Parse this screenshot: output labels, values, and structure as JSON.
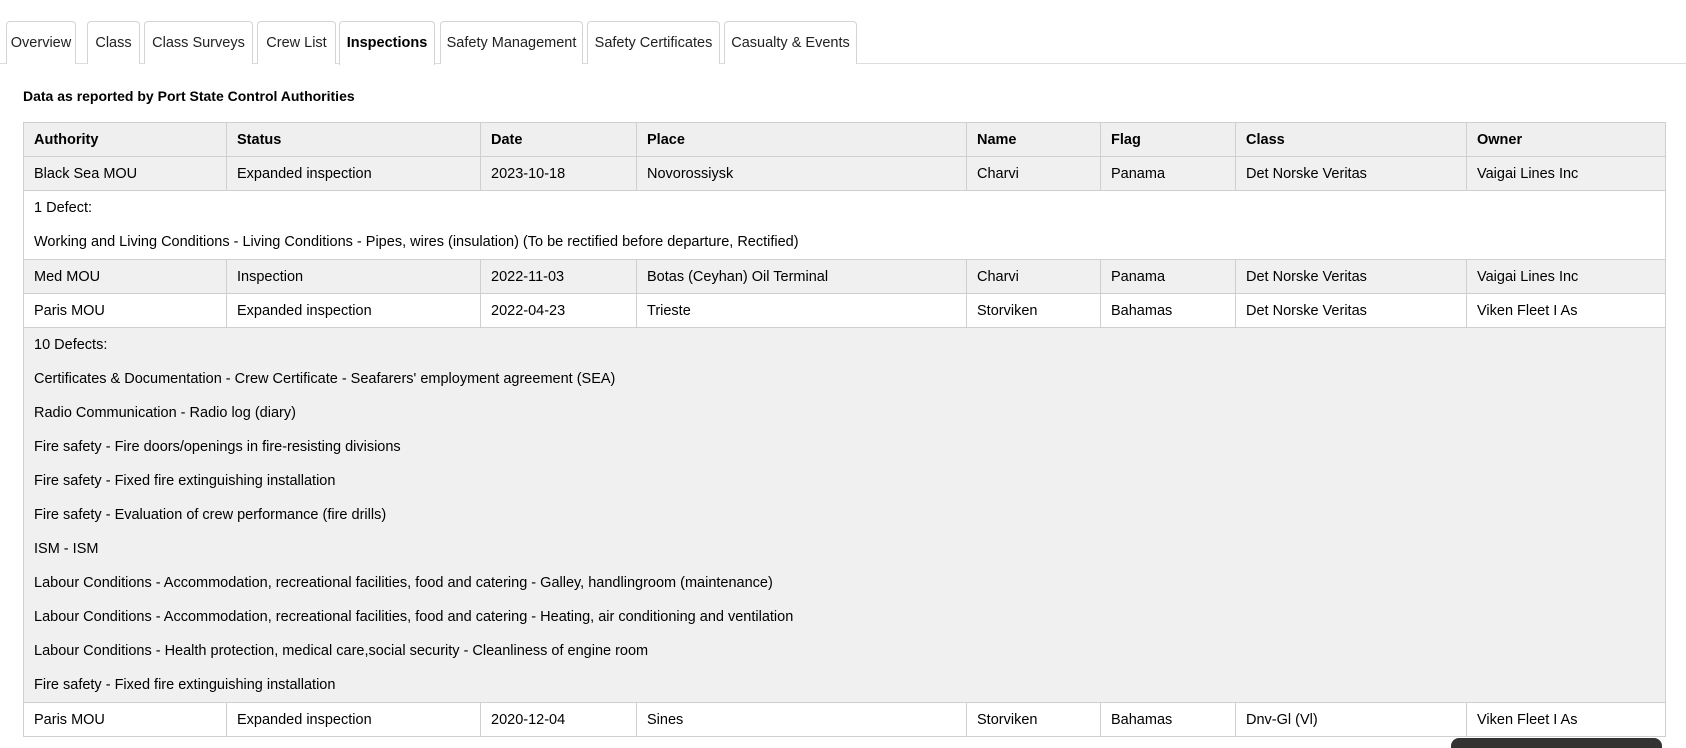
{
  "tabs": [
    {
      "label": "Overview",
      "active": false
    },
    {
      "label": "Class",
      "active": false
    },
    {
      "label": "Class Surveys",
      "active": false
    },
    {
      "label": "Crew List",
      "active": false
    },
    {
      "label": "Inspections",
      "active": true
    },
    {
      "label": "Safety Management",
      "active": false
    },
    {
      "label": "Safety Certificates",
      "active": false
    },
    {
      "label": "Casualty & Events",
      "active": false
    }
  ],
  "subtitle": "Data as reported by Port State Control Authorities",
  "table": {
    "headers": [
      "Authority",
      "Status",
      "Date",
      "Place",
      "Name",
      "Flag",
      "Class",
      "Owner"
    ],
    "rows": [
      {
        "cells": [
          "Black Sea MOU",
          "Expanded inspection",
          "2023-10-18",
          "Novorossiysk",
          "Charvi",
          "Panama",
          "Det Norske Veritas",
          "Vaigai Lines Inc"
        ],
        "defects": {
          "count_label": "1 Defect:",
          "items": [
            "Working and Living Conditions - Living Conditions - Pipes, wires (insulation) (To be rectified before departure, Rectified)"
          ]
        }
      },
      {
        "cells": [
          "Med MOU",
          "Inspection",
          "2022-11-03",
          "Botas (Ceyhan) Oil Terminal",
          "Charvi",
          "Panama",
          "Det Norske Veritas",
          "Vaigai Lines Inc"
        ]
      },
      {
        "cells": [
          "Paris MOU",
          "Expanded inspection",
          "2022-04-23",
          "Trieste",
          "Storviken",
          "Bahamas",
          "Det Norske Veritas",
          "Viken Fleet I As"
        ],
        "defects": {
          "count_label": "10 Defects:",
          "items": [
            "Certificates & Documentation - Crew Certificate - Seafarers' employment agreement (SEA)",
            "Radio Communication - Radio log (diary)",
            "Fire safety - Fire doors/openings in fire-resisting divisions",
            "Fire safety - Fixed fire extinguishing installation",
            "Fire safety - Evaluation of crew performance (fire drills)",
            "ISM - ISM",
            "Labour Conditions - Accommodation, recreational facilities, food and catering - Galley, handlingroom (maintenance)",
            "Labour Conditions - Accommodation, recreational facilities, food and catering - Heating, air conditioning and ventilation",
            "Labour Conditions - Health protection, medical care,social security - Cleanliness of engine room",
            "Fire safety - Fixed fire extinguishing installation"
          ]
        }
      },
      {
        "cells": [
          "Paris MOU",
          "Expanded inspection",
          "2020-12-04",
          "Sines",
          "Storviken",
          "Bahamas",
          "Dnv-Gl (Vl)",
          "Viken Fleet I As"
        ]
      }
    ]
  },
  "colors": {
    "header_bg": "#efefef",
    "row_grey": "#f0f0f0",
    "row_white": "#ffffff",
    "border": "#cfcfcf"
  }
}
